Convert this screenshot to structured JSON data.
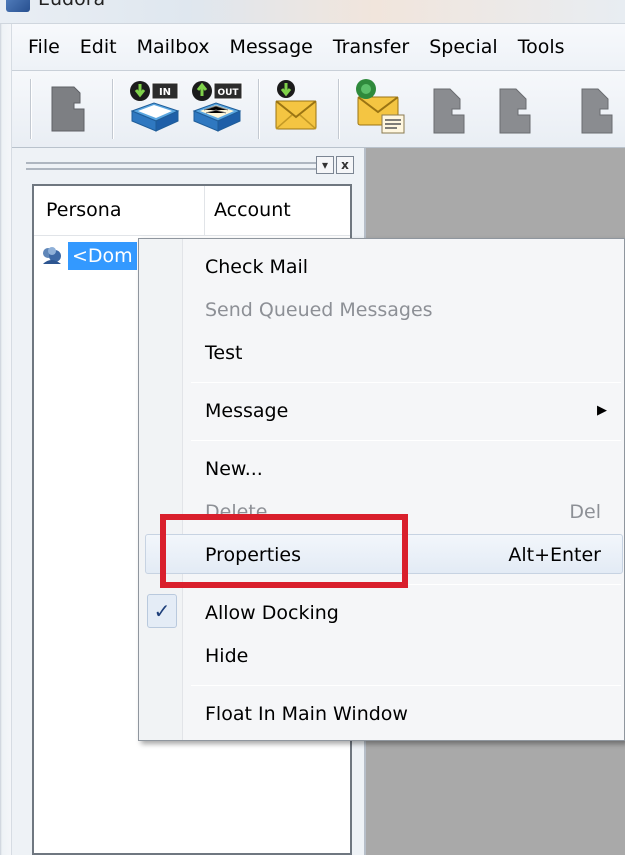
{
  "window": {
    "title": "Eudora"
  },
  "menubar": {
    "items": [
      "File",
      "Edit",
      "Mailbox",
      "Message",
      "Transfer",
      "Special",
      "Tools"
    ]
  },
  "toolbar": {
    "buttons": [
      {
        "icon": "persona-silhouette-icon"
      },
      {
        "icon": "inbox-in-icon",
        "badge": "IN"
      },
      {
        "icon": "outbox-out-icon",
        "badge": "OUT"
      },
      {
        "icon": "check-mail-icon"
      },
      {
        "icon": "new-message-icon"
      },
      {
        "icon": "reply-icon"
      },
      {
        "icon": "reply-all-icon"
      }
    ]
  },
  "panel": {
    "close_glyph": "x",
    "pin_glyph": "▾",
    "columns": [
      "Persona",
      "Account"
    ],
    "rows": [
      {
        "persona": "<Dom"
      }
    ]
  },
  "context_menu": {
    "items": {
      "check_mail": "Check Mail",
      "send_queued": "Send Queued Messages",
      "test": "Test",
      "message": "Message",
      "new": "New...",
      "delete": "Delete",
      "delete_shortcut": "Del",
      "properties": "Properties",
      "properties_shortcut": "Alt+Enter",
      "allow_docking": "Allow Docking",
      "hide": "Hide",
      "float": "Float In Main Window"
    },
    "check_glyph": "✓",
    "submenu_glyph": "▶"
  },
  "colors": {
    "highlight": "#d91f2c",
    "selection": "#3399ff",
    "content_bg": "#a9a9a9"
  }
}
